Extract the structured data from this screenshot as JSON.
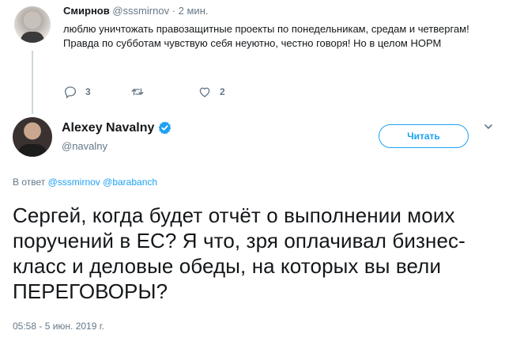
{
  "parent_tweet": {
    "display_name": "Смирнов",
    "handle": "@sssmirnov",
    "separator": "·",
    "time": "2 мин.",
    "text": "люблю уничтожать правозащитные проекты по понедельникам, средам и четвергам! Правда по субботам чувствую себя неуютно, честно говоря! Но в целом НОРМ",
    "reply_count": "3",
    "retweet_count": "",
    "like_count": "2"
  },
  "main_tweet": {
    "display_name": "Alexey Navalny",
    "handle": "@navalny",
    "follow_label": "Читать",
    "reply_to_prefix": "В ответ",
    "mention_1": "@sssmirnov",
    "mention_2": "@barabanch",
    "text": "Сергей, когда будет отчёт о выполнении моих поручений в ЕС? Я что, зря оплачивал бизнес-класс и деловые обеды, на которых вы вели ПЕРЕГОВОРЫ?",
    "timestamp": "05:58 - 5 июн. 2019 г."
  },
  "colors": {
    "accent": "#1da1f2",
    "muted": "#657786",
    "text": "#14171a",
    "thread_line": "#ccd6dd"
  },
  "icons": [
    "reply-icon",
    "retweet-icon",
    "like-icon",
    "verified-badge-icon",
    "chevron-down-icon"
  ]
}
